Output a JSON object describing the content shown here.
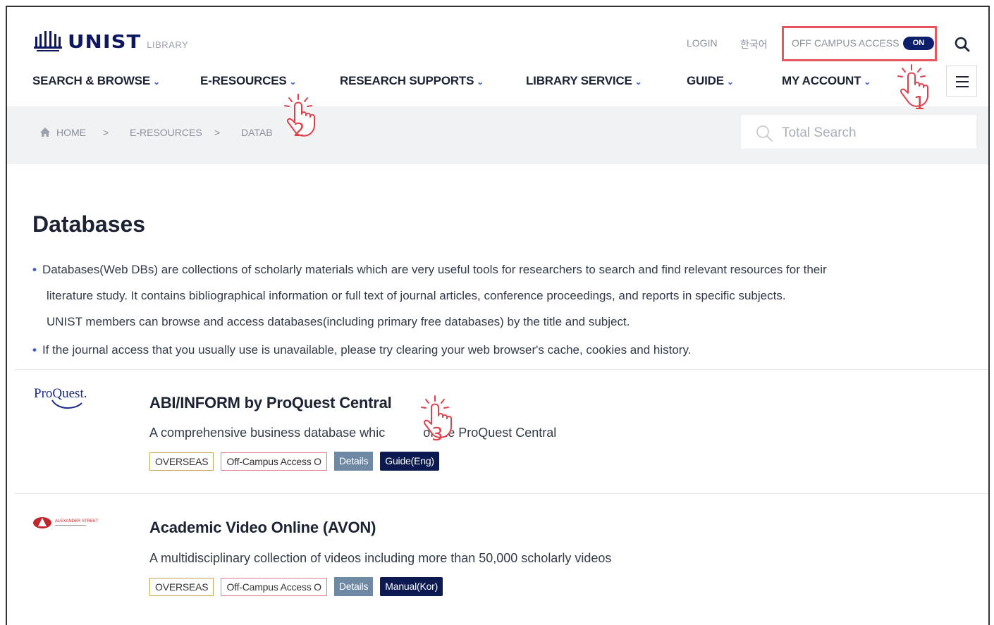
{
  "header": {
    "logo_text": "UNIST",
    "logo_sub": "LIBRARY",
    "login": "LOGIN",
    "language": "한국어",
    "off_campus_label": "OFF CAMPUS ACCESS",
    "off_campus_state": "ON"
  },
  "nav": {
    "items": [
      {
        "label": "SEARCH & BROWSE"
      },
      {
        "label": "E-RESOURCES"
      },
      {
        "label": "RESEARCH SUPPORTS"
      },
      {
        "label": "LIBRARY SERVICE"
      },
      {
        "label": "GUIDE"
      },
      {
        "label": "MY ACCOUNT"
      }
    ]
  },
  "breadcrumb": {
    "home": "HOME",
    "level1": "E-RESOURCES",
    "level2": "DATAB",
    "sep": ">"
  },
  "search": {
    "placeholder": "Total Search"
  },
  "page": {
    "title": "Databases",
    "bullet1_line1": "Databases(Web DBs) are collections of scholarly materials which are very useful tools for researchers to search and find relevant resources for their",
    "bullet1_line2": "literature study. It contains bibliographical information or full text of journal articles, conference proceedings, and reports in specific subjects.",
    "bullet1_line3": "UNIST members can browse and access databases(including primary free databases) by the title and subject.",
    "bullet2": "If the journal access that you usually use is unavailable, please try clearing your web browser's cache, cookies and history."
  },
  "databases": [
    {
      "logo_text": "ProQuest.",
      "title": "ABI/INFORM by ProQuest Central",
      "desc_start": "A comprehensive business database whic",
      "desc_end": "of the ProQuest Central",
      "tag_region": "OVERSEAS",
      "tag_access": "Off-Campus Access O",
      "tag_details": "Details",
      "tag_guide": "Guide(Eng)"
    },
    {
      "logo_text": "ALEXANDER STREET",
      "title": "Academic Video Online (AVON)",
      "desc": "A multidisciplinary collection of videos including more than 50,000 scholarly videos",
      "tag_region": "OVERSEAS",
      "tag_access": "Off-Campus Access O",
      "tag_details": "Details",
      "tag_guide": "Manual(Kor)"
    }
  ],
  "markers": [
    "1",
    "2",
    "3"
  ],
  "colors": {
    "brand_navy": "#0d1660",
    "accent_blue": "#3b5bdb",
    "highlight_red": "#e8555c",
    "details_gray": "#6f89a5"
  }
}
